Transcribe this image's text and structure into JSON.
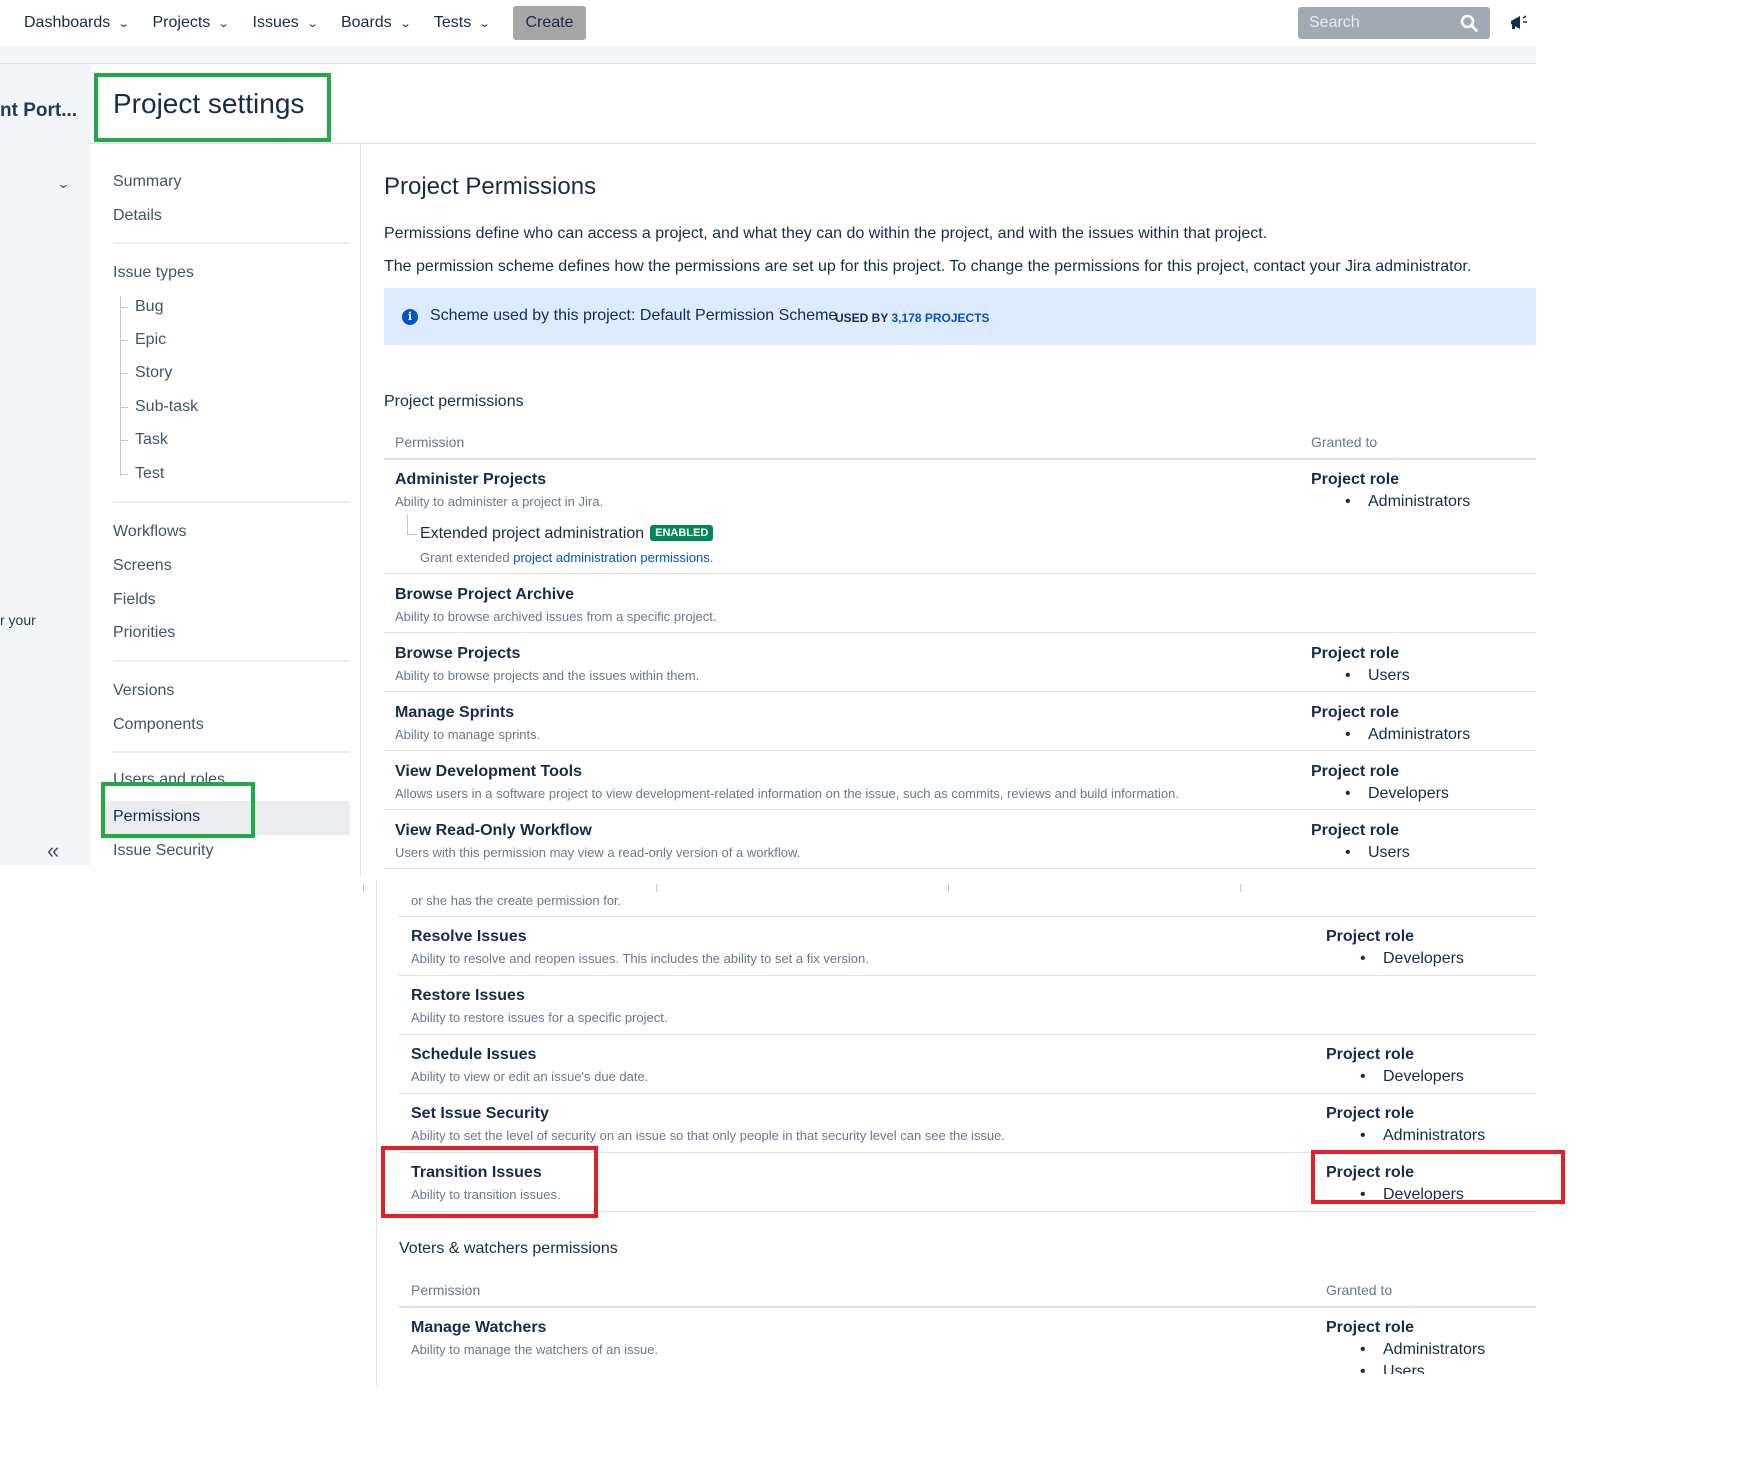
{
  "topnav": {
    "items": [
      {
        "label": "Dashboards"
      },
      {
        "label": "Projects"
      },
      {
        "label": "Issues"
      },
      {
        "label": "Boards"
      },
      {
        "label": "Tests"
      }
    ],
    "create_label": "Create",
    "search_placeholder": "Search"
  },
  "outer_sidebar": {
    "project_name": "nt Port...",
    "cut_text": "r your"
  },
  "settings": {
    "title": "Project settings",
    "nav": {
      "summary": "Summary",
      "details": "Details",
      "issue_types": "Issue types",
      "types": [
        "Bug",
        "Epic",
        "Story",
        "Sub-task",
        "Task",
        "Test"
      ],
      "workflows": "Workflows",
      "screens": "Screens",
      "fields": "Fields",
      "priorities": "Priorities",
      "versions": "Versions",
      "components": "Components",
      "users_and_roles": "Users and roles",
      "permissions": "Permissions",
      "issue_security": "Issue Security"
    }
  },
  "main": {
    "heading": "Project Permissions",
    "para1": "Permissions define who can access a project, and what they can do within the project, and with the issues within that project.",
    "para2": "The permission scheme defines how the permissions are set up for this project. To change the permissions for this project, contact your Jira administrator.",
    "scheme": {
      "text": "Scheme used by this project: Default Permission Scheme",
      "used_by_prefix": "USED BY",
      "used_by_link": "3,178 PROJECTS"
    },
    "project_permissions": {
      "title": "Project permissions",
      "col_permission": "Permission",
      "col_granted": "Granted to",
      "rows": [
        {
          "name": "Administer Projects",
          "desc": "Ability to administer a project in Jira.",
          "role": "Project role",
          "grant": "Administrators"
        },
        {
          "name": "Browse Project Archive",
          "desc": "Ability to browse archived issues from a specific project."
        },
        {
          "name": "Browse Projects",
          "desc": "Ability to browse projects and the issues within them.",
          "role": "Project role",
          "grant": "Users"
        },
        {
          "name": "Manage Sprints",
          "desc": "Ability to manage sprints.",
          "role": "Project role",
          "grant": "Administrators"
        },
        {
          "name": "View Development Tools",
          "desc": "Allows users in a software project to view development-related information on the issue, such as commits, reviews and build information.",
          "role": "Project role",
          "grant": "Developers"
        },
        {
          "name": "View Read-Only Workflow",
          "desc": "Users with this permission may view a read-only version of a workflow.",
          "role": "Project role",
          "grant": "Users"
        }
      ],
      "extended": {
        "label": "Extended project administration",
        "badge": "ENABLED",
        "desc_prefix": "Grant extended",
        "desc_link": "project administration permissions",
        "desc_suffix": "."
      }
    },
    "lower": {
      "truncated_text": "or she has the create permission for.",
      "rows": [
        {
          "name": "Resolve Issues",
          "desc": "Ability to resolve and reopen issues. This includes the ability to set a fix version.",
          "role": "Project role",
          "grant": "Developers"
        },
        {
          "name": "Restore Issues",
          "desc": "Ability to restore issues for a specific project."
        },
        {
          "name": "Schedule Issues",
          "desc": "Ability to view or edit an issue's due date.",
          "role": "Project role",
          "grant": "Developers"
        },
        {
          "name": "Set Issue Security",
          "desc": "Ability to set the level of security on an issue so that only people in that security level can see the issue.",
          "role": "Project role",
          "grant": "Administrators"
        },
        {
          "name": "Transition Issues",
          "desc": "Ability to transition issues.",
          "role": "Project role",
          "grant": "Developers"
        }
      ]
    },
    "voters": {
      "title": "Voters & watchers permissions",
      "col_permission": "Permission",
      "col_granted": "Granted to",
      "rows": [
        {
          "name": "Manage Watchers",
          "desc": "Ability to manage the watchers of an issue.",
          "role": "Project role",
          "grants": [
            "Administrators",
            "Users"
          ]
        }
      ]
    }
  }
}
